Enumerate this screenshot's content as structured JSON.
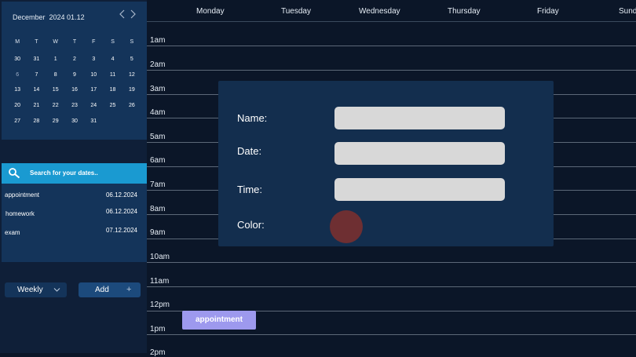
{
  "mini_calendar": {
    "month_label": "December",
    "date_label": "2024 01.12",
    "weekday_headers": [
      "M",
      "T",
      "W",
      "T",
      "F",
      "S",
      "S"
    ],
    "weeks": [
      [
        "30",
        "31",
        "1",
        "2",
        "3",
        "4",
        "5"
      ],
      [
        "6",
        "7",
        "8",
        "9",
        "10",
        "11",
        "12"
      ],
      [
        "13",
        "14",
        "15",
        "16",
        "17",
        "18",
        "19"
      ],
      [
        "20",
        "21",
        "22",
        "23",
        "24",
        "25",
        "26"
      ],
      [
        "27",
        "28",
        "29",
        "30",
        "31",
        "",
        ""
      ]
    ]
  },
  "search": {
    "placeholder": "Search for your dates.."
  },
  "results": [
    {
      "name": "appointment",
      "date": "06.12.2024"
    },
    {
      "name": "homework",
      "date": "06.12.2024"
    },
    {
      "name": "exam",
      "date": "07.12.2024"
    }
  ],
  "view_select": {
    "value": "Weekly"
  },
  "add_button": {
    "label": "Add",
    "icon_text": "+"
  },
  "week_days": [
    "Monday",
    "Tuesday",
    "Wednesday",
    "Thursday",
    "Friday",
    "Sunday"
  ],
  "hours": [
    "1am",
    "2am",
    "3am",
    "4am",
    "5am",
    "6am",
    "7am",
    "8am",
    "9am",
    "10am",
    "11am",
    "12pm",
    "1pm",
    "2pm"
  ],
  "event_chip": {
    "label": "appointment",
    "color": "#9d99ee"
  },
  "modal": {
    "name_label": "Name:",
    "date_label": "Date:",
    "time_label": "Time:",
    "color_label": "Color:",
    "name_value": "",
    "date_value": "",
    "time_value": "",
    "selected_color": "#6e2f32"
  },
  "icons": {
    "prev": "chevron-left-icon",
    "next": "chevron-right-icon",
    "search": "search-icon",
    "dropdown": "chevron-down-icon",
    "add": "plus-icon"
  }
}
